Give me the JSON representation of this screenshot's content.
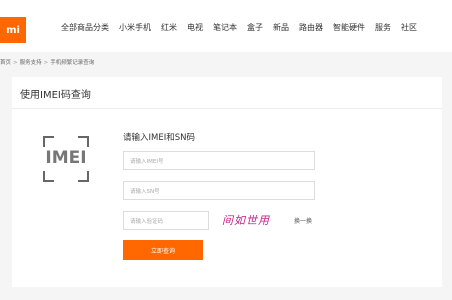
{
  "header": {
    "logo_text": "mi",
    "nav": [
      "全部商品分类",
      "小米手机",
      "红米",
      "电视",
      "笔记本",
      "盒子",
      "新品",
      "路由器",
      "智能硬件",
      "服务",
      "社区"
    ]
  },
  "breadcrumb": {
    "items": [
      "首页",
      "服务支持",
      "手机频繁记录查询"
    ],
    "separator": ">"
  },
  "page": {
    "title": "使用IMEI码查询",
    "imei_label": "IMEI"
  },
  "form": {
    "heading": "请输入IMEI和SN码",
    "imei_placeholder": "请输入IMEI号",
    "sn_placeholder": "请输入SN号",
    "captcha_placeholder": "请输入验证码",
    "captcha_text": "间如世用",
    "refresh_label": "换一换",
    "submit_label": "立即查询"
  },
  "colors": {
    "brand": "#ff6700",
    "captcha": "#c2288a"
  }
}
